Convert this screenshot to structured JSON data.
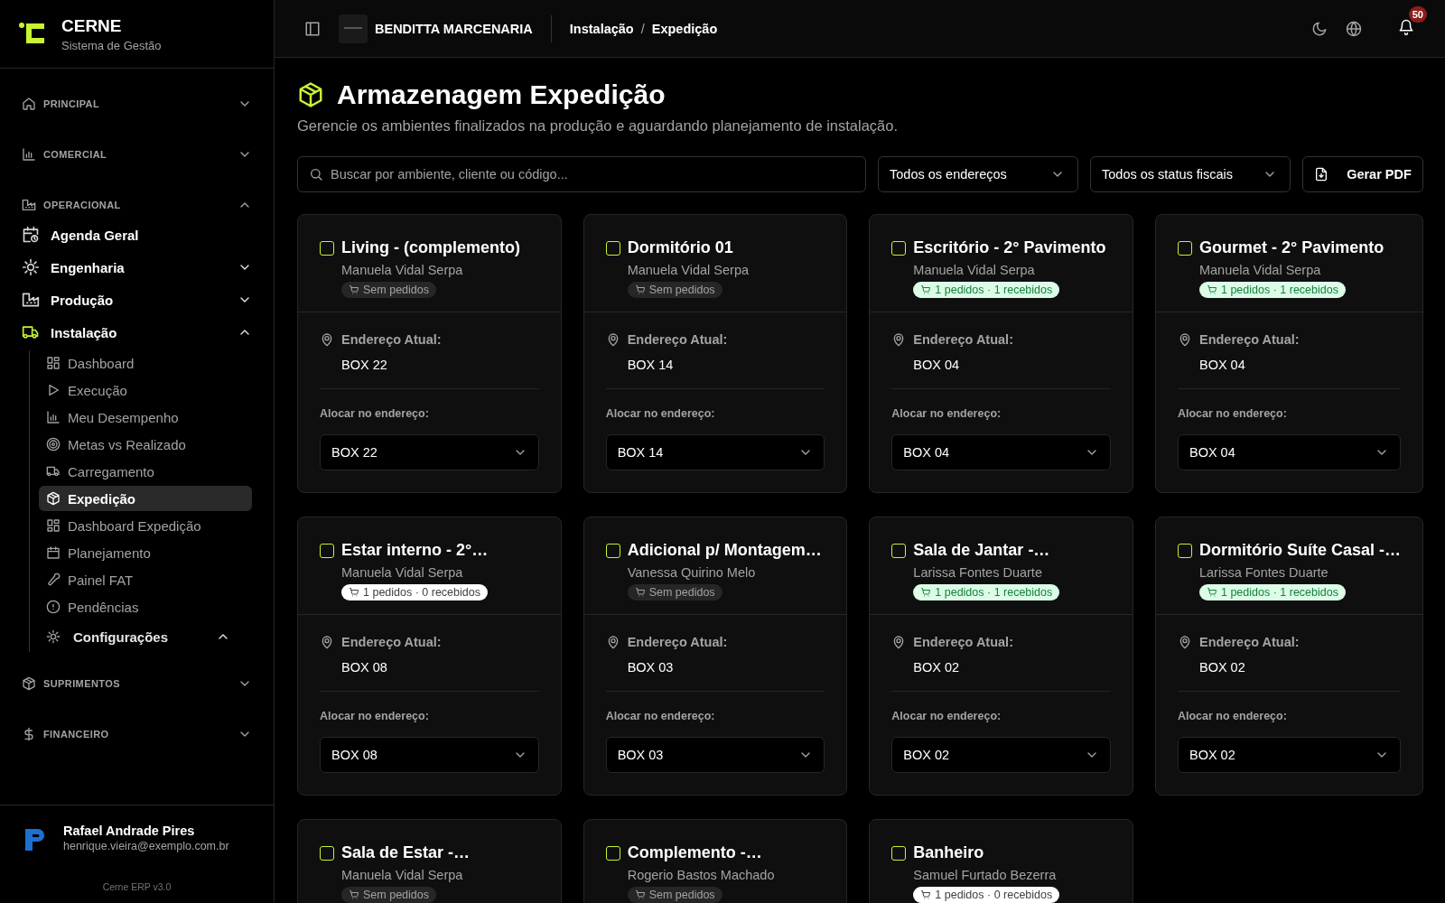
{
  "sidebar": {
    "brand": {
      "name": "CERNE",
      "subtitle": "Sistema de Gestão"
    },
    "sections": [
      {
        "label": "PRINCIPAL",
        "expanded": false
      },
      {
        "label": "COMERCIAL",
        "expanded": false
      },
      {
        "label": "OPERACIONAL",
        "expanded": true,
        "items": [
          {
            "label": "Agenda Geral",
            "selected": false
          },
          {
            "label": "Engenharia",
            "selected": false,
            "expanded": false
          },
          {
            "label": "Produção",
            "selected": false,
            "expanded": false
          },
          {
            "label": "Instalação",
            "selected": true,
            "expanded": true,
            "children": [
              {
                "label": "Dashboard",
                "selected": false
              },
              {
                "label": "Execução",
                "selected": false
              },
              {
                "label": "Meu Desempenho",
                "selected": false
              },
              {
                "label": "Metas vs Realizado",
                "selected": false
              },
              {
                "label": "Carregamento",
                "selected": false
              },
              {
                "label": "Expedição",
                "selected": true
              },
              {
                "label": "Dashboard Expedição",
                "selected": false
              },
              {
                "label": "Planejamento",
                "selected": false
              },
              {
                "label": "Painel FAT",
                "selected": false
              },
              {
                "label": "Pendências",
                "selected": false
              },
              {
                "label": "Configurações",
                "selected": false,
                "expanded": true
              }
            ]
          }
        ]
      },
      {
        "label": "SUPRIMENTOS",
        "expanded": false
      },
      {
        "label": "FINANCEIRO",
        "expanded": false
      }
    ],
    "user": {
      "name": "Rafael Andrade Pires",
      "email": "henrique.vieira@exemplo.com.br"
    },
    "version": "Cerne ERP v3.0"
  },
  "header": {
    "company": "BENDITTA MARCENARIA",
    "breadcrumbs": [
      "Instalação",
      "/",
      "Expedição"
    ],
    "notifications": "50"
  },
  "page": {
    "title": "Armazenagem Expedição",
    "subtitle": "Gerencie os ambientes finalizados na produção e aguardando planejamento de instalação.",
    "search": {
      "placeholder": "Buscar por ambiente, cliente ou código..."
    },
    "filters": [
      "Todos os endereços",
      "Todos os status fiscais"
    ],
    "pdf_button": "Gerar PDF",
    "cards": [
      {
        "title": "Living - (complemento)",
        "client": "Manuela Vidal Serpa",
        "checked": false,
        "orders": {
          "kind": "none",
          "label": "Sem pedidos"
        },
        "address_label": "Endereço Atual:",
        "current_address": "BOX 22",
        "allocate_label": "Alocar no endereço:",
        "allocate": "BOX 22"
      },
      {
        "title": "Dormitório 01",
        "client": "Manuela Vidal Serpa",
        "checked": false,
        "orders": {
          "kind": "none",
          "label": "Sem pedidos"
        },
        "address_label": "Endereço Atual:",
        "current_address": "BOX 14",
        "allocate_label": "Alocar no endereço:",
        "allocate": "BOX 14"
      },
      {
        "title": "Escritório - 2° Pavimento",
        "client": "Manuela Vidal Serpa",
        "checked": false,
        "orders": {
          "kind": "received",
          "label": "1 pedidos · 1 recebidos"
        },
        "address_label": "Endereço Atual:",
        "current_address": "BOX 04",
        "allocate_label": "Alocar no endereço:",
        "allocate": "BOX 04"
      },
      {
        "title": "Gourmet - 2° Pavimento",
        "client": "Manuela Vidal Serpa",
        "checked": false,
        "orders": {
          "kind": "received",
          "label": "1 pedidos · 1 recebidos"
        },
        "address_label": "Endereço Atual:",
        "current_address": "BOX 04",
        "allocate_label": "Alocar no endereço:",
        "allocate": "BOX 04"
      },
      {
        "title": "Estar interno - 2°…",
        "client": "Manuela Vidal Serpa",
        "checked": false,
        "orders": {
          "kind": "pending",
          "label": "1 pedidos · 0 recebidos"
        },
        "address_label": "Endereço Atual:",
        "current_address": "BOX 08",
        "allocate_label": "Alocar no endereço:",
        "allocate": "BOX 08"
      },
      {
        "title": "Adicional p/ Montagem…",
        "client": "Vanessa Quirino Melo",
        "checked": false,
        "orders": {
          "kind": "none",
          "label": "Sem pedidos"
        },
        "address_label": "Endereço Atual:",
        "current_address": "BOX 03",
        "allocate_label": "Alocar no endereço:",
        "allocate": "BOX 03"
      },
      {
        "title": "Sala de Jantar -…",
        "client": "Larissa Fontes Duarte",
        "checked": false,
        "orders": {
          "kind": "received",
          "label": "1 pedidos · 1 recebidos"
        },
        "address_label": "Endereço Atual:",
        "current_address": "BOX 02",
        "allocate_label": "Alocar no endereço:",
        "allocate": "BOX 02"
      },
      {
        "title": "Dormitório Suíte Casal -…",
        "client": "Larissa Fontes Duarte",
        "checked": false,
        "orders": {
          "kind": "received",
          "label": "1 pedidos · 1 recebidos"
        },
        "address_label": "Endereço Atual:",
        "current_address": "BOX 02",
        "allocate_label": "Alocar no endereço:",
        "allocate": "BOX 02"
      },
      {
        "title": "Sala de Estar -…",
        "client": "Manuela Vidal Serpa",
        "checked": false,
        "orders": {
          "kind": "none",
          "label": "Sem pedidos"
        }
      },
      {
        "title": "Complemento -…",
        "client": "Rogerio Bastos Machado",
        "checked": false,
        "orders": {
          "kind": "none",
          "label": "Sem pedidos"
        }
      },
      {
        "title": "Banheiro",
        "client": "Samuel Furtado Bezerra",
        "checked": false,
        "orders": {
          "kind": "pending",
          "label": "1 pedidos · 0 recebidos"
        }
      }
    ]
  }
}
